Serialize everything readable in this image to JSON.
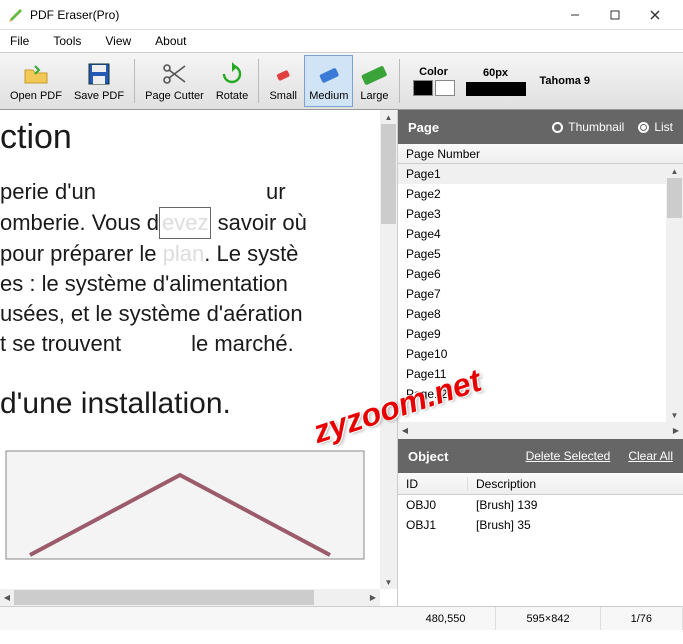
{
  "title": "PDF Eraser(Pro)",
  "menus": {
    "file": "File",
    "tools": "Tools",
    "view": "View",
    "about": "About"
  },
  "toolbar": {
    "open": "Open PDF",
    "save": "Save PDF",
    "cutter": "Page Cutter",
    "rotate": "Rotate",
    "small": "Small",
    "medium": "Medium",
    "large": "Large",
    "color": "Color",
    "size": "60px",
    "font": "Tahoma 9"
  },
  "document": {
    "heading1": "ction",
    "line1a": "perie d'un",
    "line1b": "ur",
    "line2a": "omberie. Vous d",
    "line2era": "evez",
    "line2b": " savoir où",
    "line3a": "pour préparer le",
    "line3era": " plan",
    "line3b": ". Le systè",
    "line4": "es : le système d'alimentation",
    "line5": "usées, et le système d'aération",
    "line6a": "t se trouvent",
    "line6b": "le marché.",
    "heading2": "d'une installation."
  },
  "watermark": "zyzoom.net",
  "sidepanel": {
    "page_header": "Page",
    "thumbnail": "Thumbnail",
    "list": "List",
    "page_col": "Page Number",
    "pages": [
      "Page1",
      "Page2",
      "Page3",
      "Page4",
      "Page5",
      "Page6",
      "Page7",
      "Page8",
      "Page9",
      "Page10",
      "Page11",
      "Page12"
    ],
    "object_header": "Object",
    "delete_selected": "Delete Selected",
    "clear_all": "Clear All",
    "obj_col_id": "ID",
    "obj_col_desc": "Description",
    "objects": [
      {
        "id": "OBJ0",
        "desc": "[Brush] 139"
      },
      {
        "id": "OBJ1",
        "desc": "[Brush] 35"
      }
    ]
  },
  "status": {
    "coords": "480,550",
    "dims": "595×842",
    "page": "1/76"
  }
}
